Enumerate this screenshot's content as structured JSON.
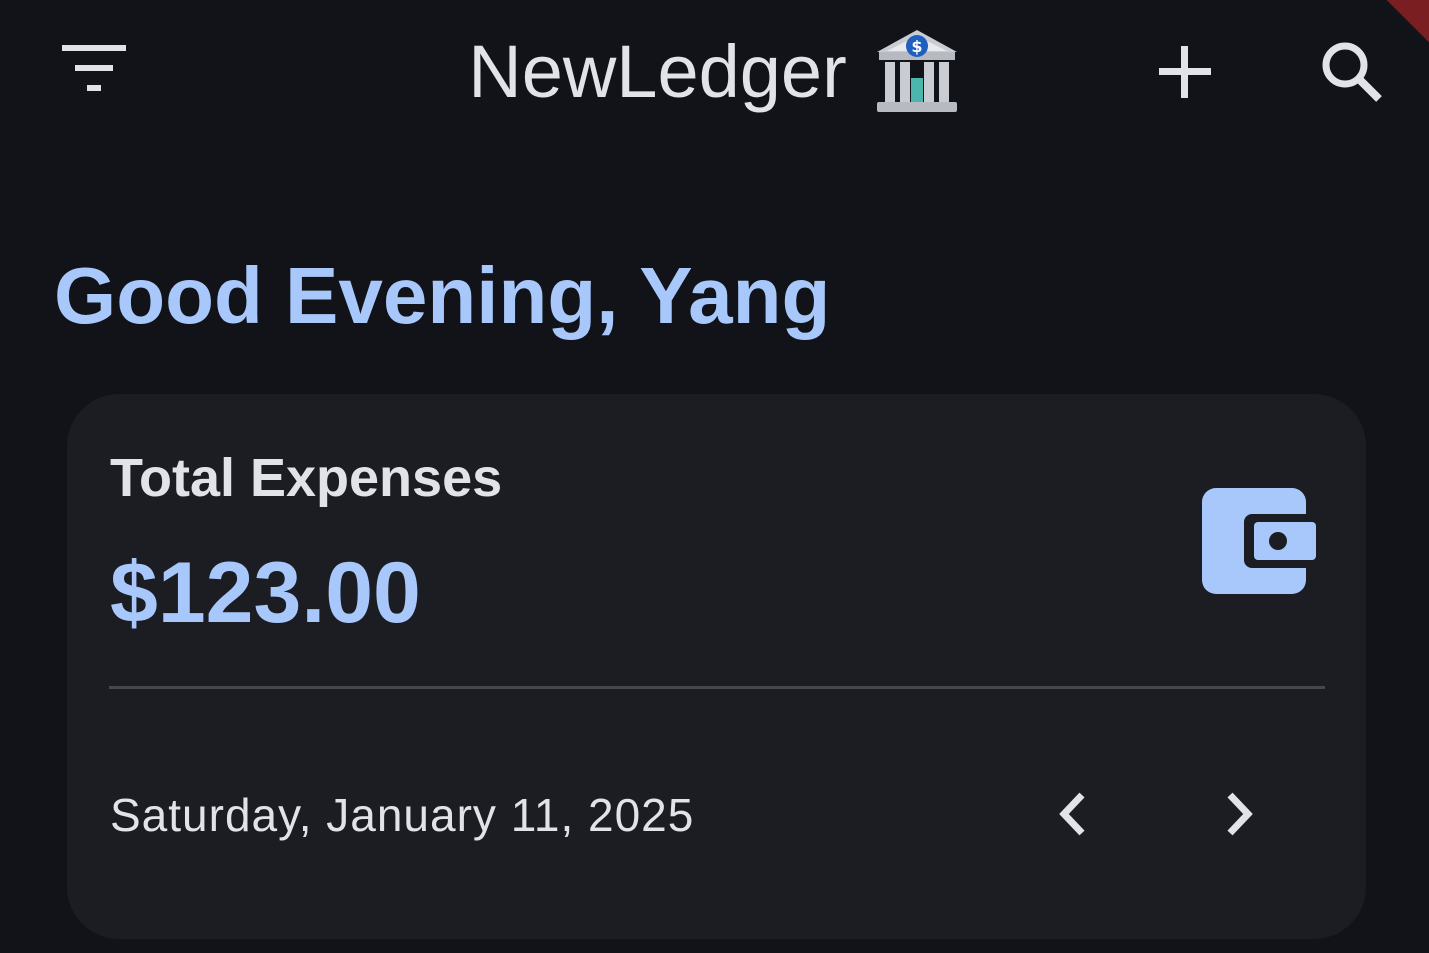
{
  "app_bar": {
    "title": "NewLedger",
    "title_icon": "bank-icon",
    "actions": {
      "filter_icon": "filter-icon",
      "add_icon": "add-icon",
      "search_icon": "search-icon"
    }
  },
  "greeting": "Good Evening, Yang",
  "summary_card": {
    "label": "Total Expenses",
    "amount": "$123.00",
    "icon": "wallet-icon",
    "date": "Saturday, January 11, 2025",
    "prev_icon": "chevron-left-icon",
    "next_icon": "chevron-right-icon"
  },
  "colors": {
    "background": "#111318",
    "card": "#1b1d22",
    "accent": "#a8c8fb",
    "text": "#e2e2e9",
    "divider": "#44474e"
  }
}
